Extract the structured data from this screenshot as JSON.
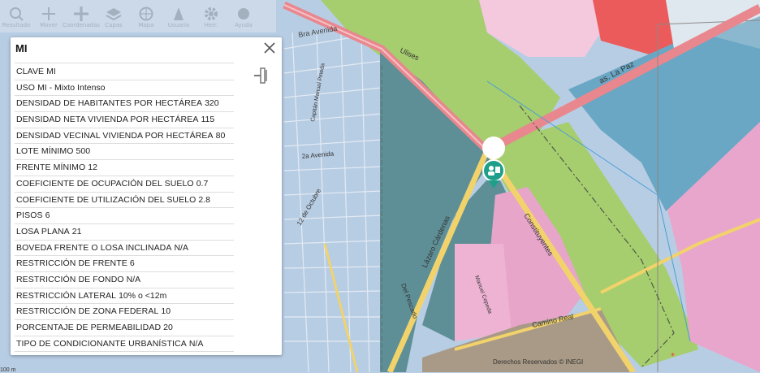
{
  "toolbar": {
    "items": [
      {
        "label": "Resultado",
        "icon": "search-icon"
      },
      {
        "label": "Mover",
        "icon": "pan-icon"
      },
      {
        "label": "Coordenadas",
        "icon": "crosshair-icon"
      },
      {
        "label": "Capas",
        "icon": "layers-icon"
      },
      {
        "label": "Mapa",
        "icon": "globe-icon"
      },
      {
        "label": "Usuario",
        "icon": "person-icon"
      },
      {
        "label": "Herr.",
        "icon": "gear-icon"
      },
      {
        "label": "Ayuda",
        "icon": "help-icon"
      }
    ]
  },
  "popup": {
    "title": "MI",
    "rows": [
      {
        "label": "CLAVE",
        "value": "MI"
      },
      {
        "label": "USO",
        "value": "MI - Mixto Intenso"
      },
      {
        "label": "DENSIDAD DE HABITANTES POR HECTÁREA",
        "value": "320"
      },
      {
        "label": "DENSIDAD NETA VIVIENDA POR HECTÁREA",
        "value": "115"
      },
      {
        "label": "DENSIDAD VECINAL VIVIENDA POR HECTÁREA",
        "value": "80"
      },
      {
        "label": "LOTE MÍNIMO",
        "value": "500"
      },
      {
        "label": "FRENTE MÍNIMO",
        "value": "12"
      },
      {
        "label": "COEFICIENTE DE OCUPACIÓN DEL SUELO",
        "value": "0.7"
      },
      {
        "label": "COEFICIENTE DE UTILIZACIÓN DEL SUELO",
        "value": "2.8"
      },
      {
        "label": "PISOS",
        "value": "6"
      },
      {
        "label": "LOSA PLANA",
        "value": "21"
      },
      {
        "label": "BOVEDA FRENTE O LOSA INCLINADA",
        "value": "N/A"
      },
      {
        "label": "RESTRICCIÓN DE FRENTE",
        "value": "6"
      },
      {
        "label": "RESTRICCIÓN DE FONDO",
        "value": "N/A"
      },
      {
        "label": "RESTRICCIÓN LATERAL",
        "value": "10% o <12m"
      },
      {
        "label": "RESTRICCIÓN DE ZONA FEDERAL",
        "value": "10"
      },
      {
        "label": "PORCENTAJE DE PERMEABILIDAD",
        "value": "20"
      },
      {
        "label": "TIPO DE CONDICIONANTE URBANÍSTICA",
        "value": "N/A"
      }
    ]
  },
  "map": {
    "streets": [
      "Bra Avenida",
      "Ulises",
      "as. La Paz",
      "2a Avenida",
      "Capitán Manuel Pineda",
      "12 de Octubre",
      "Lázaro Cárdenas",
      "Constituyentes",
      "Camino Real",
      "Del Pescado",
      "Manuel Cepeda"
    ],
    "credit": "Derechos Reservados © INEGI",
    "scale": "100 m"
  }
}
